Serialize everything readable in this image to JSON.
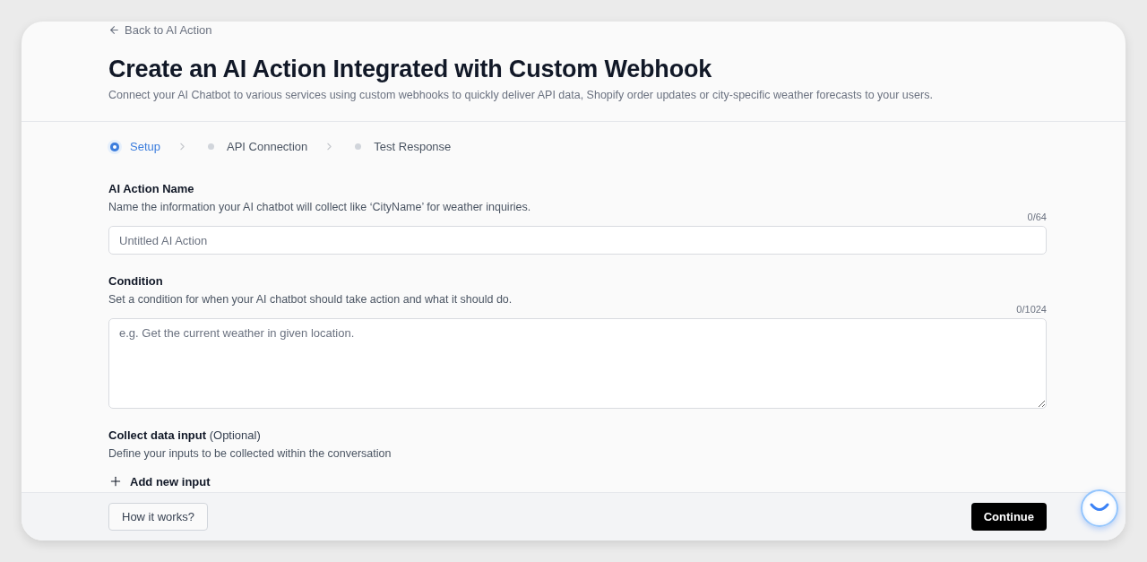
{
  "back_link": {
    "label": "Back to AI Action"
  },
  "header": {
    "title": "Create an AI Action Integrated with Custom Webhook",
    "subtitle": "Connect your AI Chatbot to various services using custom webhooks to quickly deliver API data, Shopify order updates or city-specific weather forecasts to your users."
  },
  "steps": [
    {
      "label": "Setup",
      "selected": true
    },
    {
      "label": "API Connection",
      "selected": false
    },
    {
      "label": "Test Response",
      "selected": false
    }
  ],
  "fields": [
    {
      "kind": "input",
      "label": "AI Action Name",
      "description": "Name the information your AI chatbot will collect like ‘CityName’ for weather inquiries.",
      "counter": "0/64",
      "placeholder": "Untitled AI Action"
    },
    {
      "kind": "textarea",
      "label": "Condition",
      "description": "Set a condition for when your AI chatbot should take action and what it should do.",
      "counter": "0/1024",
      "placeholder": "e.g. Get the current weather in given location."
    }
  ],
  "collect_section": {
    "label": "Collect data input",
    "label_note": "(Optional)",
    "description": "Define your inputs to be collected within the conversation",
    "add_button": "Add new input"
  },
  "footer": {
    "help_button": "How it works?",
    "continue_button": "Continue"
  }
}
